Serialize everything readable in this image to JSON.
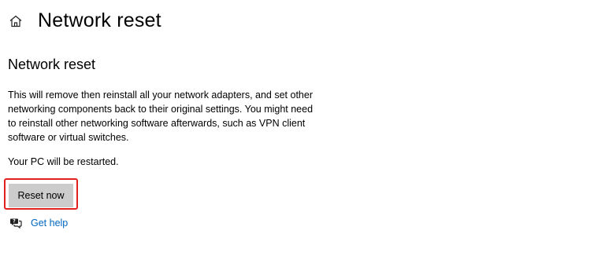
{
  "header": {
    "title": "Network reset",
    "home_icon": "home-icon"
  },
  "section": {
    "title": "Network reset",
    "description": "This will remove then reinstall all your network adapters, and set other networking components back to their original settings. You might need to reinstall other networking software afterwards, such as VPN client software or virtual switches.",
    "restart_note": "Your PC will be restarted."
  },
  "actions": {
    "reset_label": "Reset now",
    "highlight_color": "#e02020",
    "button_color": "#cccccc"
  },
  "help": {
    "icon": "get-help-icon",
    "label": "Get help",
    "link_color": "#0067c0"
  }
}
